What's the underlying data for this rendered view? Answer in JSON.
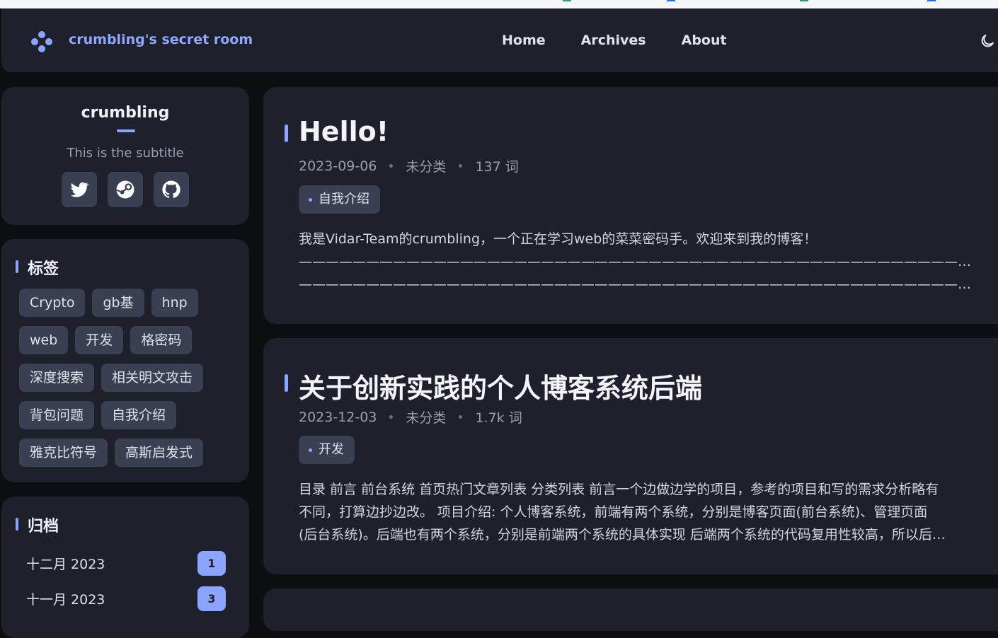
{
  "site": {
    "title": "crumbling's secret room"
  },
  "nav": {
    "home": "Home",
    "archives": "Archives",
    "about": "About"
  },
  "profile": {
    "name": "crumbling",
    "subtitle": "This is the subtitle"
  },
  "tags_section": {
    "title": "标签",
    "tags": [
      "Crypto",
      "gb基",
      "hnp",
      "web",
      "开发",
      "格密码",
      "深度搜索",
      "相关明文攻击",
      "背包问题",
      "自我介绍",
      "雅克比符号",
      "高斯启发式"
    ]
  },
  "archive_section": {
    "title": "归档",
    "items": [
      {
        "label": "十二月 2023",
        "count": "1"
      },
      {
        "label": "十一月 2023",
        "count": "3"
      }
    ]
  },
  "posts": [
    {
      "title": "Hello!",
      "date": "2023-09-06",
      "category": "未分类",
      "words": "137 词",
      "tag": "自我介绍",
      "excerpt_lines": [
        "我是Vidar-Team的crumbling，一个正在学习web的菜菜密码手。欢迎来到我的博客！",
        "————————————————————————————————————————————————————————————",
        "————————————————————————————————————————————————————————————…"
      ]
    },
    {
      "title": "关于创新实践的个人博客系统后端",
      "date": "2023-12-03",
      "category": "未分类",
      "words": "1.7k 词",
      "tag": "开发",
      "excerpt_lines": [
        "目录 前言 前台系统 首页热门文章列表 分类列表 前言一个边做边学的项目，参考的项目和写的需求分析略有",
        "不同，打算边抄边改。 项目介绍: 个人博客系统，前端有两个系统，分别是博客页面(前台系统)、管理页面",
        "(后台系统)。后端也有两个系统，分别是前端两个系统的具体实现 后端两个系统的代码复用性较高，所以后…"
      ]
    }
  ],
  "colors": {
    "accent": "#8aa4ff",
    "card": "#1e202b",
    "background": "#0d0e12",
    "chip": "#3a3f52"
  },
  "icons": [
    "app-logo-icon",
    "moon-icon",
    "twitter-icon",
    "steam-icon",
    "github-icon"
  ]
}
